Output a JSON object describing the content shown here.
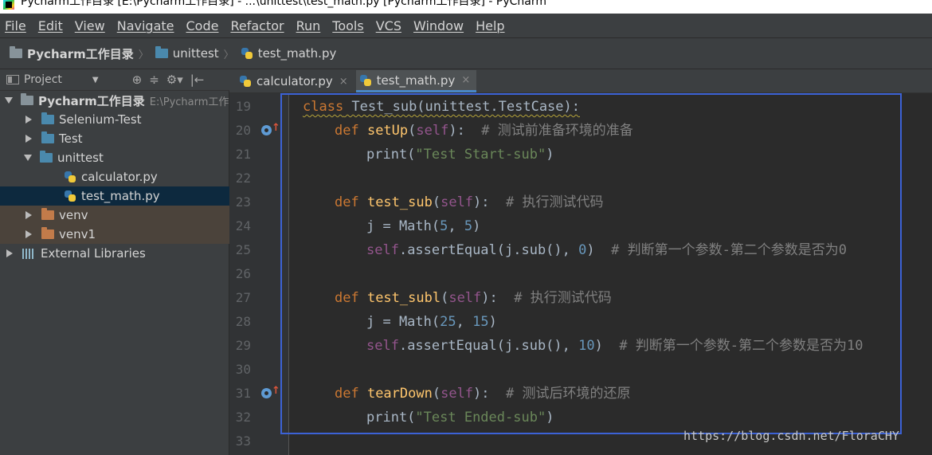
{
  "window": {
    "title": "Pycharm工作目录 [E:\\Pycharm工作目录] - ...\\unittest\\test_math.py [Pycharm工作目录] - PyCharm"
  },
  "menu": [
    "File",
    "Edit",
    "View",
    "Navigate",
    "Code",
    "Refactor",
    "Run",
    "Tools",
    "VCS",
    "Window",
    "Help"
  ],
  "breadcrumb": [
    "Pycharm工作目录",
    "unittest",
    "test_math.py"
  ],
  "project_panel": {
    "title": "Project",
    "toolbar_icons": [
      "⊕",
      "≑",
      "⚙▾",
      "|←"
    ]
  },
  "tree": [
    {
      "label": "Pycharm工作目录",
      "path": "E:\\Pycharm工作",
      "icon": "folder-icon",
      "expanded": true,
      "indent": 0
    },
    {
      "label": "Selenium-Test",
      "icon": "folder-icon",
      "indent": 1
    },
    {
      "label": "Test",
      "icon": "folder-icon",
      "indent": 1
    },
    {
      "label": "unittest",
      "icon": "folder-icon",
      "expanded": true,
      "indent": 1
    },
    {
      "label": "calculator.py",
      "icon": "python-file-icon",
      "indent": 2
    },
    {
      "label": "test_math.py",
      "icon": "python-file-icon",
      "indent": 2,
      "selected": true
    },
    {
      "label": "venv",
      "icon": "folder-icon",
      "indent": 1,
      "excluded": true
    },
    {
      "label": "venv1",
      "icon": "folder-icon",
      "indent": 1,
      "excluded": true
    },
    {
      "label": "External Libraries",
      "icon": "library-icon",
      "indent": 0
    }
  ],
  "tabs": [
    {
      "label": "calculator.py",
      "close": "×",
      "active": false
    },
    {
      "label": "test_math.py",
      "close": "×",
      "active": true
    }
  ],
  "code": [
    {
      "n": "19",
      "tokens": [
        [
          "kw wavy",
          "class"
        ],
        [
          "plain wavy",
          " Test_sub(unittest.TestCase):"
        ]
      ],
      "fold": "open"
    },
    {
      "n": "20",
      "indent": 1,
      "tokens": [
        [
          "kw",
          "def "
        ],
        [
          "fn",
          "setUp"
        ],
        [
          "plain",
          "("
        ],
        [
          "slf",
          "self"
        ],
        [
          "plain",
          "):  "
        ],
        [
          "cm",
          "# 测试前准备环境的准备"
        ]
      ],
      "fold": "open",
      "override": true
    },
    {
      "n": "21",
      "indent": 2,
      "tokens": [
        [
          "plain",
          "print("
        ],
        [
          "str",
          "\"Test Start-sub\""
        ],
        [
          "plain",
          ")"
        ]
      ],
      "fold": "close"
    },
    {
      "n": "22",
      "tokens": []
    },
    {
      "n": "23",
      "indent": 1,
      "tokens": [
        [
          "kw",
          "def "
        ],
        [
          "fn",
          "test_sub"
        ],
        [
          "plain",
          "("
        ],
        [
          "slf",
          "self"
        ],
        [
          "plain",
          "):  "
        ],
        [
          "cm",
          "# 执行测试代码"
        ]
      ],
      "fold": "open"
    },
    {
      "n": "24",
      "indent": 2,
      "tokens": [
        [
          "plain",
          "j = Math("
        ],
        [
          "num",
          "5"
        ],
        [
          "plain",
          ", "
        ],
        [
          "num",
          "5"
        ],
        [
          "plain",
          ")"
        ]
      ]
    },
    {
      "n": "25",
      "indent": 2,
      "tokens": [
        [
          "slf",
          "self"
        ],
        [
          "plain",
          ".assertEqual(j.sub(), "
        ],
        [
          "num",
          "0"
        ],
        [
          "plain",
          ")  "
        ],
        [
          "cm",
          "# 判断第一个参数-第二个参数是否为0"
        ]
      ],
      "fold": "close"
    },
    {
      "n": "26",
      "tokens": []
    },
    {
      "n": "27",
      "indent": 1,
      "tokens": [
        [
          "kw",
          "def "
        ],
        [
          "fn",
          "test_subl"
        ],
        [
          "plain",
          "("
        ],
        [
          "slf",
          "self"
        ],
        [
          "plain",
          "):  "
        ],
        [
          "cm",
          "# 执行测试代码"
        ]
      ],
      "fold": "open"
    },
    {
      "n": "28",
      "indent": 2,
      "tokens": [
        [
          "plain",
          "j = Math("
        ],
        [
          "num",
          "25"
        ],
        [
          "plain",
          ", "
        ],
        [
          "num",
          "15"
        ],
        [
          "plain",
          ")"
        ]
      ]
    },
    {
      "n": "29",
      "indent": 2,
      "tokens": [
        [
          "slf",
          "self"
        ],
        [
          "plain",
          ".assertEqual(j.sub(), "
        ],
        [
          "num",
          "10"
        ],
        [
          "plain",
          ")  "
        ],
        [
          "cm",
          "# 判断第一个参数-第二个参数是否为10"
        ]
      ],
      "fold": "close"
    },
    {
      "n": "30",
      "tokens": []
    },
    {
      "n": "31",
      "indent": 1,
      "tokens": [
        [
          "kw",
          "def "
        ],
        [
          "fn",
          "tearDown"
        ],
        [
          "plain",
          "("
        ],
        [
          "slf",
          "self"
        ],
        [
          "plain",
          "):  "
        ],
        [
          "cm",
          "# 测试后环境的还原"
        ]
      ],
      "fold": "open",
      "override": true
    },
    {
      "n": "32",
      "indent": 2,
      "tokens": [
        [
          "plain",
          "print("
        ],
        [
          "str",
          "\"Test Ended-sub\""
        ],
        [
          "plain",
          ")"
        ]
      ],
      "fold": "close"
    },
    {
      "n": "33",
      "tokens": []
    }
  ],
  "watermark": "https://blog.csdn.net/FloraCHY",
  "colors": {
    "keyword": "#cc7832",
    "function": "#ffc66d",
    "self": "#94558d",
    "number": "#6897bb",
    "string": "#6a8759",
    "comment": "#808080",
    "highlight_box": "#3c62d6"
  }
}
